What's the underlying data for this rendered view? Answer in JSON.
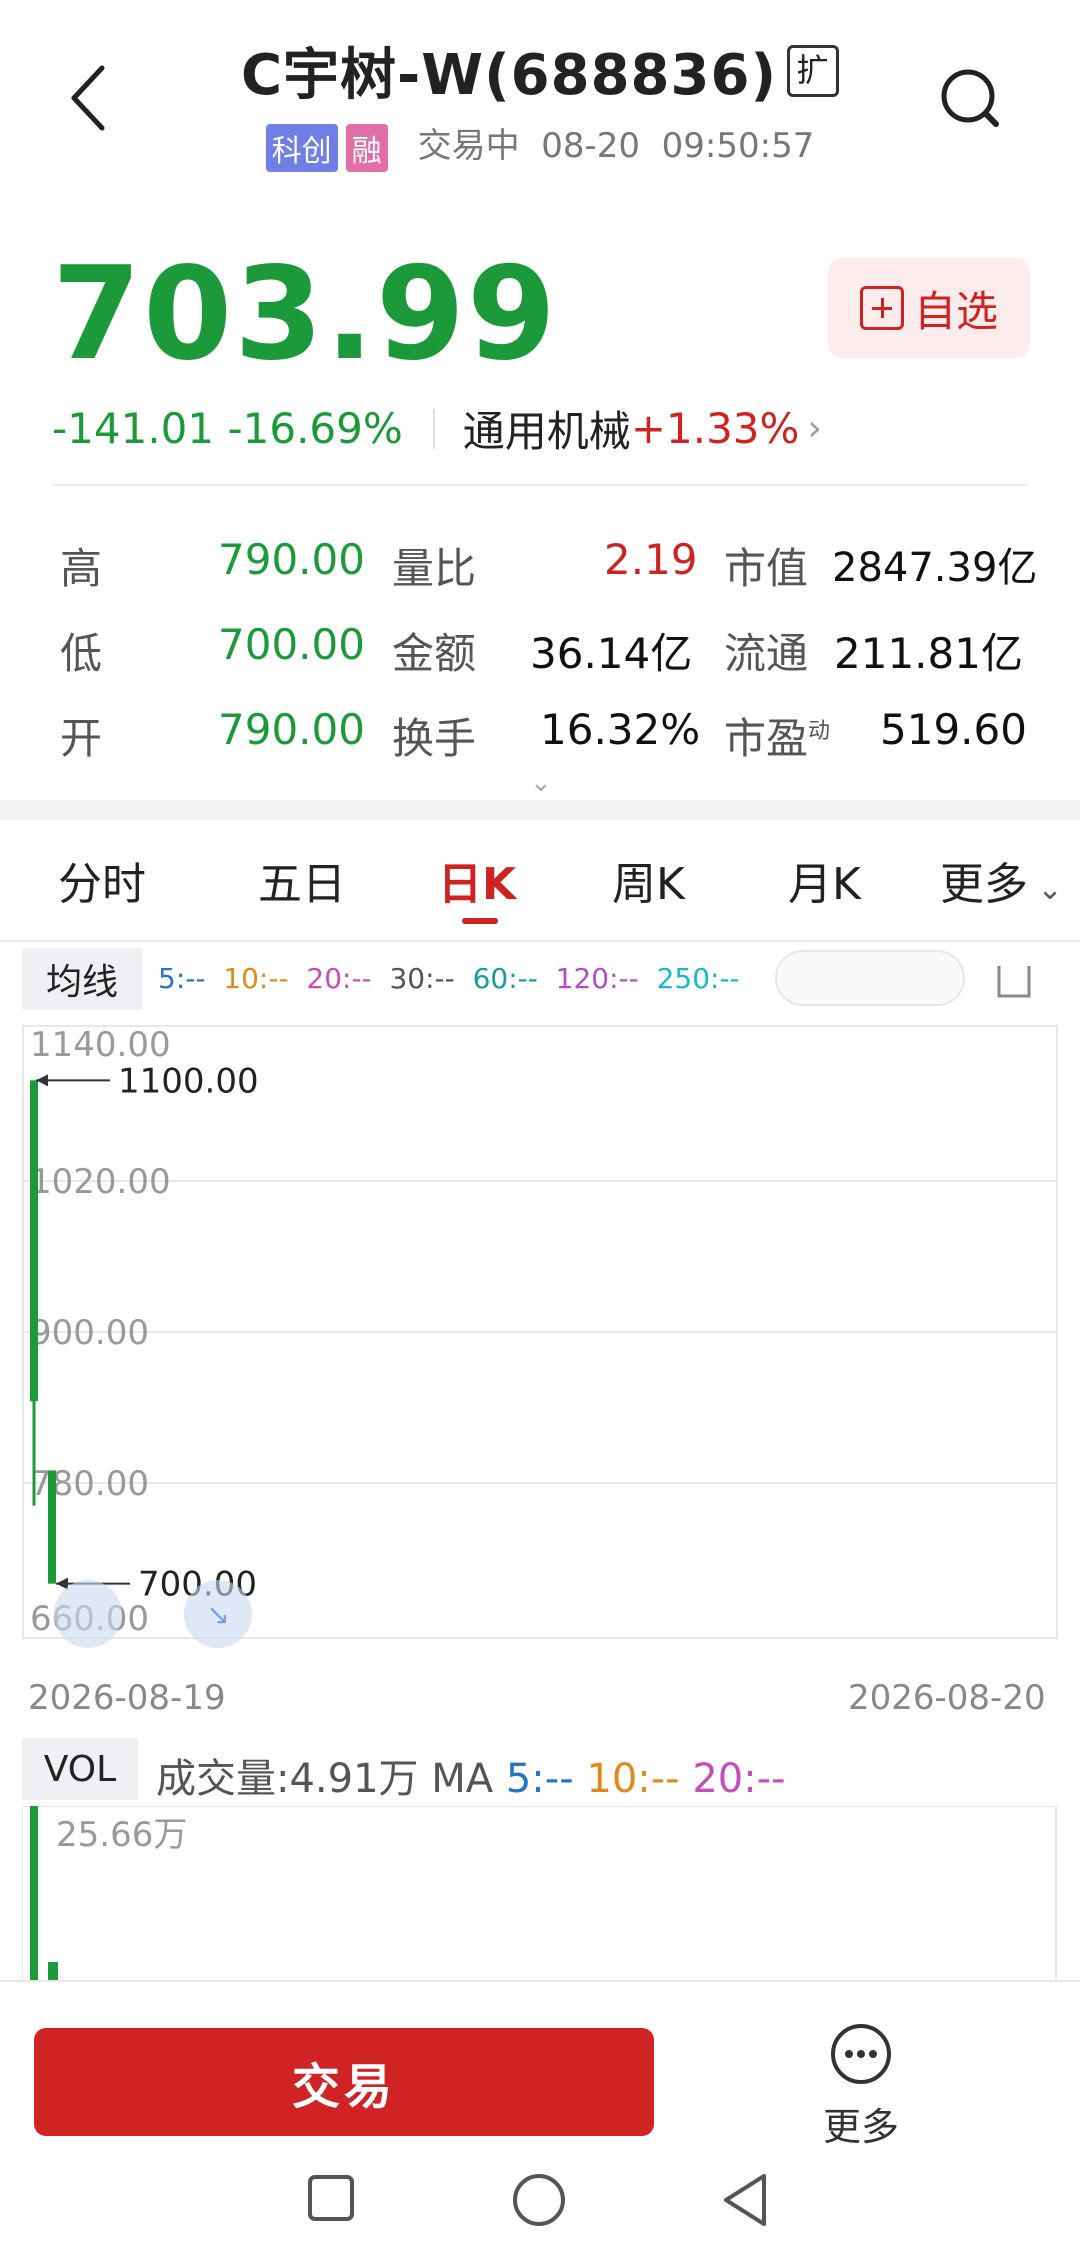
{
  "header": {
    "title": "C宇树-W(688836)",
    "expand_badge": "扩",
    "tag_board": "科创",
    "tag_margin": "融",
    "status": "交易中",
    "date": "08-20",
    "time": "09:50:57"
  },
  "quote": {
    "price": "703.99",
    "change": "-141.01",
    "change_pct": "-16.69%",
    "sector_name": "通用机械",
    "sector_pct": "+1.33%",
    "watch_label": "自选"
  },
  "stats": {
    "high_label": "高",
    "high": "790.00",
    "low_label": "低",
    "low": "700.00",
    "open_label": "开",
    "open": "790.00",
    "vol_ratio_label": "量比",
    "vol_ratio": "2.19",
    "amount_label": "金额",
    "amount": "36.14亿",
    "turnover_label": "换手",
    "turnover": "16.32%",
    "mktcap_label": "市值",
    "mktcap": "2847.39亿",
    "float_label": "流通",
    "float_cap": "211.81亿",
    "pe_label": "市盈",
    "pe_sup": "动",
    "pe": "519.60"
  },
  "tabs": {
    "intraday": "分时",
    "five_day": "五日",
    "daily": "日K",
    "weekly": "周K",
    "monthly": "月K",
    "more": "更多"
  },
  "ma": {
    "label": "均线",
    "ma5": "5:--",
    "ma10": "10:--",
    "ma20": "20:--",
    "ma30": "30:--",
    "ma60": "60:--",
    "ma120": "120:--",
    "ma250": "250:--"
  },
  "chart_data": {
    "type": "candlestick",
    "y_ticks": [
      "1140.00",
      "1020.00",
      "900.00",
      "780.00",
      "660.00"
    ],
    "ylim": [
      660,
      1140
    ],
    "max_label": "1100.00",
    "min_label": "700.00",
    "x_start": "2026-08-19",
    "x_end": "2026-08-20",
    "candles": [
      {
        "date": "2026-08-19",
        "high": 1100,
        "low": 762,
        "bar_top": 1100,
        "bar_bottom": 845
      },
      {
        "date": "2026-08-20",
        "open": 790,
        "high": 790,
        "low": 700,
        "close": 703.99
      }
    ],
    "colors": {
      "down": "#1c9a3a",
      "grid": "#e8e8e8"
    }
  },
  "volume": {
    "label": "VOL",
    "text": "成交量:4.91万 MA",
    "ma5": "5:--",
    "ma10": "10:--",
    "ma20": "20:--",
    "max_tick": "25.66万"
  },
  "bottom": {
    "trade_label": "交易",
    "more_label": "更多"
  }
}
